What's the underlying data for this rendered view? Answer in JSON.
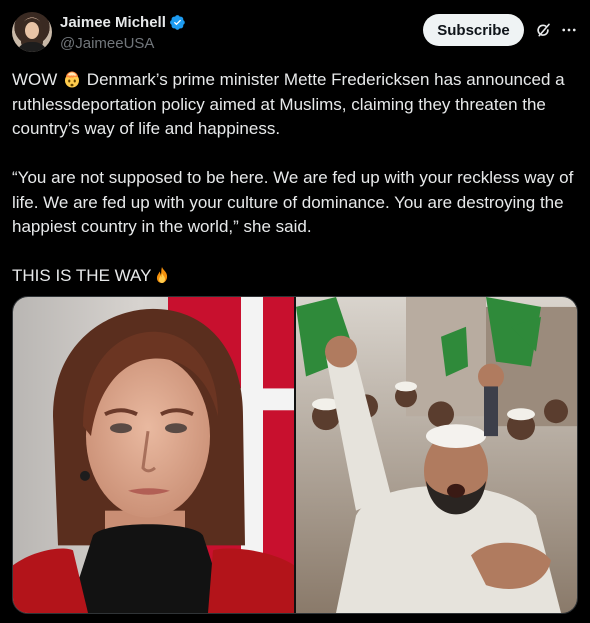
{
  "author": {
    "display_name": "Jaimee Michell",
    "handle": "@JaimeeUSA",
    "verified": true,
    "avatar_icon": "profile-photo"
  },
  "actions": {
    "subscribe_label": "Subscribe",
    "grok_icon": "grok-icon",
    "more_icon": "more-icon"
  },
  "tweet": {
    "line1_prefix": "WOW",
    "line1_suffix": "Denmark’s prime minister Mette Fredericksen has announced a ruthlessdeportation policy aimed at Muslims, claiming they threaten the country’s way of life and happiness.",
    "quote": "“You are not supposed to be here. We are fed up with your reckless way of life. We are fed up with your culture of dominance. You are destroying the happiest country in the world,” she said.",
    "closing": "THIS IS THE WAY",
    "emoji_1": "exploding-head",
    "emoji_2": "fire"
  },
  "media": {
    "left_image": "portrait-woman-flag",
    "right_image": "crowd-protest-flags"
  },
  "colors": {
    "background": "#000000",
    "text": "#e7e9ea",
    "muted": "#71767b",
    "verified": "#1d9bf0",
    "button_bg": "#eff3f4",
    "button_text": "#0f1419",
    "border": "#2f3336"
  }
}
